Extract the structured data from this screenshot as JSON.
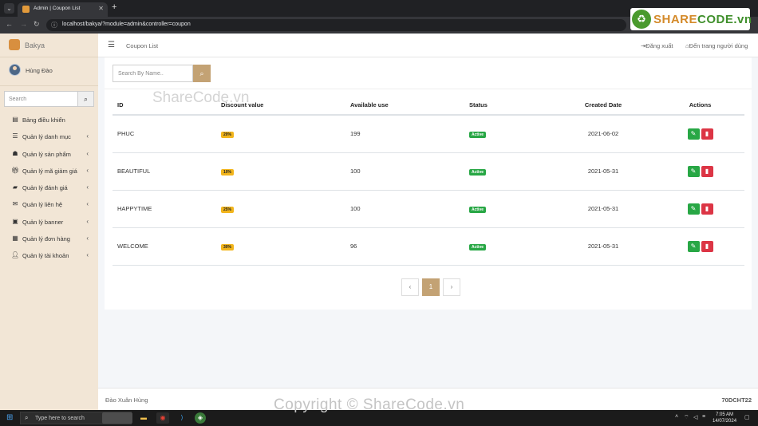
{
  "browser": {
    "tab_title": "Admin | Coupon List",
    "url": "localhost/bakya/?module=admin&controller=coupon"
  },
  "watermark_logo": {
    "text_a": "SHARE",
    "text_b": "CODE.vn"
  },
  "sidebar": {
    "brand": "Bakya",
    "user_name": "Hùng Đào",
    "search_placeholder": "Search",
    "items": [
      {
        "label": "Bảng điều khiển",
        "icon": "dashboard-icon",
        "has_arrow": false
      },
      {
        "label": "Quản lý danh mục",
        "icon": "list-icon",
        "has_arrow": true
      },
      {
        "label": "Quản lý sản phẩm",
        "icon": "product-icon",
        "has_arrow": true
      },
      {
        "label": "Quản lý mã giảm giá",
        "icon": "gift-icon",
        "has_arrow": true
      },
      {
        "label": "Quản lý đánh giá",
        "icon": "comment-icon",
        "has_arrow": true
      },
      {
        "label": "Quản lý liên hệ",
        "icon": "contact-icon",
        "has_arrow": true
      },
      {
        "label": "Quản lý banner",
        "icon": "image-icon",
        "has_arrow": true
      },
      {
        "label": "Quản lý đơn hàng",
        "icon": "order-icon",
        "has_arrow": true
      },
      {
        "label": "Quản lý tài khoản",
        "icon": "user-icon",
        "has_arrow": true
      }
    ]
  },
  "topnav": {
    "breadcrumb": "Coupon List",
    "logout": "Đăng xuất",
    "to_user_page": "Đến trang người dùng"
  },
  "content": {
    "search_placeholder": "Search By Name..",
    "columns": [
      "ID",
      "Discount value",
      "Available use",
      "Status",
      "Created Date",
      "Actions"
    ],
    "rows": [
      {
        "id": "PHUC",
        "discount": "20%",
        "available": "199",
        "status": "Active",
        "created": "2021-06-02"
      },
      {
        "id": "BEAUTIFUL",
        "discount": "10%",
        "available": "100",
        "status": "Active",
        "created": "2021-05-31"
      },
      {
        "id": "HAPPYTIME",
        "discount": "25%",
        "available": "100",
        "status": "Active",
        "created": "2021-05-31"
      },
      {
        "id": "WELCOME",
        "discount": "30%",
        "available": "96",
        "status": "Active",
        "created": "2021-05-31"
      }
    ],
    "pagination": {
      "prev": "‹",
      "current": "1",
      "next": "›"
    }
  },
  "footer": {
    "left": "Đào Xuân Hùng",
    "right": "70DCHT22"
  },
  "watermarks": {
    "center": "ShareCode.vn",
    "bottom": "Copyright © ShareCode.vn"
  },
  "taskbar": {
    "search_text": "Type here to search",
    "time": "7:05 AM",
    "date": "14/07/2024"
  },
  "colors": {
    "accent": "#c3a274",
    "sidebar_bg": "#f2e6d6",
    "edit": "#28a745",
    "delete": "#dc3545",
    "discount_badge": "#f2b51c"
  }
}
